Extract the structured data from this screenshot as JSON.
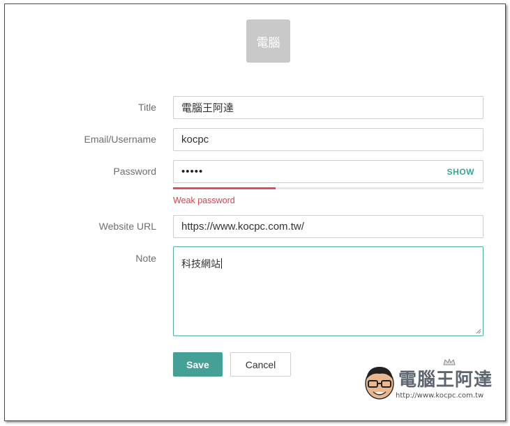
{
  "logo": {
    "text": "電腦"
  },
  "form": {
    "title": {
      "label": "Title",
      "value": "電腦王阿達"
    },
    "email": {
      "label": "Email/Username",
      "value": "kocpc"
    },
    "password": {
      "label": "Password",
      "masked_value": "•••••",
      "show_label": "SHOW",
      "strength_fraction": 0.33,
      "strength_text": "Weak password"
    },
    "website": {
      "label": "Website URL",
      "value": "https://www.kocpc.com.tw/"
    },
    "note": {
      "label": "Note",
      "value": "科技網站"
    }
  },
  "actions": {
    "save_label": "Save",
    "cancel_label": "Cancel"
  },
  "watermark": {
    "title": "電腦王阿達",
    "url": "http://www.kocpc.com.tw"
  },
  "colors": {
    "accent": "#45a196",
    "weak": "#e54a5f",
    "focus_border": "#4fb0a2"
  }
}
